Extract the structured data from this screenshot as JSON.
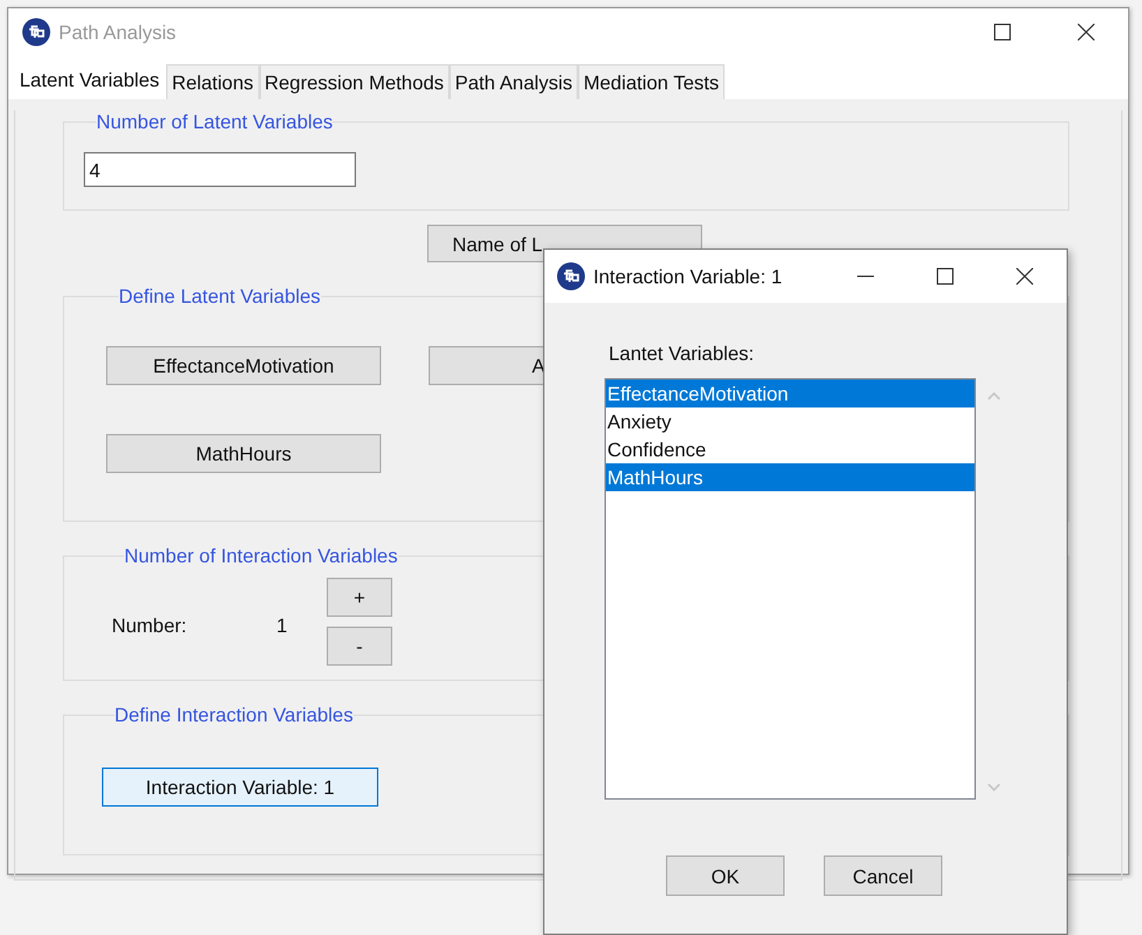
{
  "window": {
    "title": "Path Analysis"
  },
  "tabs": [
    {
      "label": "Latent Variables",
      "selected": true
    },
    {
      "label": "Relations",
      "selected": false
    },
    {
      "label": "Regression Methods",
      "selected": false
    },
    {
      "label": "Path Analysis",
      "selected": false
    },
    {
      "label": "Mediation Tests",
      "selected": false
    }
  ],
  "latent_count": {
    "legend": "Number of Latent Variables",
    "value": "4"
  },
  "name_button": "Name of L",
  "define_latent": {
    "legend": "Define Latent Variables",
    "buttons": [
      "EffectanceMotivation",
      "A",
      "MathHours"
    ]
  },
  "interaction_count": {
    "legend": "Number of Interaction Variables",
    "label": "Number:",
    "value": "1",
    "buttons": [
      "+",
      "-"
    ]
  },
  "define_interaction": {
    "legend": "Define Interaction Variables",
    "buttons": [
      {
        "label": "Interaction Variable: 1",
        "focused": true
      }
    ]
  },
  "dialog": {
    "title": "Interaction Variable: 1",
    "list_label": "Lantet Variables:",
    "items": [
      {
        "label": "EffectanceMotivation",
        "selected": true
      },
      {
        "label": "Anxiety",
        "selected": false
      },
      {
        "label": "Confidence",
        "selected": false
      },
      {
        "label": "MathHours",
        "selected": true
      }
    ],
    "buttons": [
      "OK",
      "Cancel"
    ]
  }
}
